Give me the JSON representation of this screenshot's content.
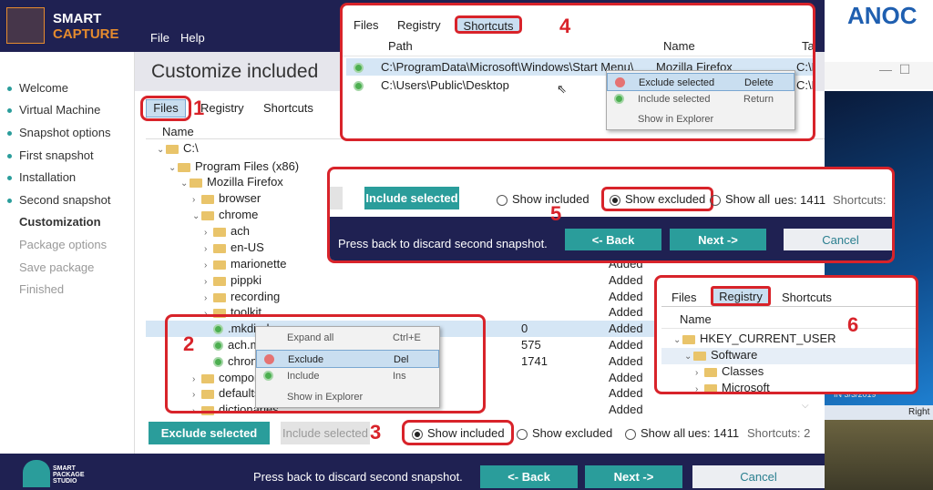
{
  "app": {
    "brand_line1": "SMART",
    "brand_line2": "CAPTURE",
    "menu": [
      "File",
      "Help"
    ],
    "footer_logo": "SMART PACKAGE STUDIO",
    "accent": "#2a9d9b",
    "navy": "#1f2152"
  },
  "sidebar": {
    "items": [
      {
        "label": "Welcome",
        "state": "done"
      },
      {
        "label": "Virtual Machine",
        "state": "done"
      },
      {
        "label": "Snapshot options",
        "state": "done"
      },
      {
        "label": "First snapshot",
        "state": "done"
      },
      {
        "label": "Installation",
        "state": "done"
      },
      {
        "label": "Second snapshot",
        "state": "done"
      },
      {
        "label": "Customization",
        "state": "current"
      },
      {
        "label": "Package options",
        "state": "pending"
      },
      {
        "label": "Save package",
        "state": "pending"
      },
      {
        "label": "Finished",
        "state": "pending"
      }
    ]
  },
  "main": {
    "title": "Customize included",
    "tabs": [
      "Files",
      "Registry",
      "Shortcuts"
    ],
    "active_tab": "Files",
    "column_name": "Name",
    "tree": [
      {
        "level": 0,
        "name": "C:\\",
        "open": true,
        "icon": "folder"
      },
      {
        "level": 1,
        "name": "Program Files (x86)",
        "open": true,
        "icon": "folder"
      },
      {
        "level": 2,
        "name": "Mozilla Firefox",
        "open": true,
        "icon": "folder-added"
      },
      {
        "level": 3,
        "name": "browser",
        "icon": "folder-added"
      },
      {
        "level": 3,
        "name": "chrome",
        "open": true,
        "icon": "folder-added"
      },
      {
        "level": 4,
        "name": "ach",
        "icon": "folder-added"
      },
      {
        "level": 4,
        "name": "en-US",
        "icon": "folder-added"
      },
      {
        "level": 4,
        "name": "marionette",
        "icon": "folder-added",
        "status": "Added"
      },
      {
        "level": 4,
        "name": "pippki",
        "icon": "folder-added",
        "status": "Added"
      },
      {
        "level": 4,
        "name": "recording",
        "icon": "folder-added",
        "status": "Added"
      },
      {
        "level": 4,
        "name": "toolkit",
        "icon": "folder-added",
        "status": "Added"
      },
      {
        "level": 4,
        "name": ".mkdir.d",
        "icon": "file-added",
        "size": "0",
        "status": "Added",
        "selected": true
      },
      {
        "level": 4,
        "name": "ach.manifest",
        "icon": "file-added",
        "size": "575",
        "status": "Added"
      },
      {
        "level": 4,
        "name": "chrome.manifest",
        "icon": "file-added",
        "size": "1741",
        "status": "Added"
      },
      {
        "level": 3,
        "name": "components",
        "icon": "folder-added",
        "status": "Added"
      },
      {
        "level": 3,
        "name": "defaults",
        "icon": "folder-added",
        "status": "Added"
      },
      {
        "level": 3,
        "name": "dictionaries",
        "icon": "folder-added",
        "status": "Added"
      }
    ],
    "context_menu": [
      {
        "label": "Expand all",
        "key": "Ctrl+E"
      },
      {
        "label": "Exclude",
        "key": "Del",
        "icon": "minus-circle-icon",
        "hover": true
      },
      {
        "label": "Include",
        "key": "Ins",
        "icon": "plus-circle-icon"
      },
      {
        "label": "Show in Explorer",
        "key": ""
      }
    ],
    "exclude_btn": "Exclude selected",
    "include_btn": "Include selected",
    "radios": [
      "Show included",
      "Show excluded",
      "Show all"
    ],
    "selected_radio": "Show included",
    "counts": "ues: 1411",
    "shortcuts_count": "Shortcuts: 2",
    "footer_hint": "Press back to discard second snapshot.",
    "back": "<- Back",
    "next": "Next ->",
    "cancel": "Cancel"
  },
  "panel4": {
    "tabs": [
      "Files",
      "Registry",
      "Shortcuts"
    ],
    "active_tab": "Shortcuts",
    "columns": [
      "Path",
      "Name",
      "Ta"
    ],
    "rows": [
      {
        "path": "C:\\ProgramData\\Microsoft\\Windows\\Start Menu\\",
        "name": "Mozilla Firefox",
        "target": "C:\\P"
      },
      {
        "path": "C:\\Users\\Public\\Desktop",
        "name": "",
        "target": "C:\\P"
      }
    ],
    "menu": [
      {
        "label": "Exclude selected",
        "key": "Delete",
        "icon": "minus-circle-icon"
      },
      {
        "label": "Include selected",
        "key": "Return",
        "icon": "plus-circle-icon"
      },
      {
        "label": "Show in Explorer",
        "key": ""
      }
    ]
  },
  "panel5": {
    "include_btn": "Include selected",
    "radios": [
      "Show included",
      "Show excluded",
      "Show all"
    ],
    "selected_radio": "Show excluded",
    "counts": "ues: 1411",
    "shortcuts": "Shortcuts: ",
    "hint": "Press back to discard second snapshot.",
    "back": "<- Back",
    "next": "Next ->",
    "cancel": "Cancel"
  },
  "panel6": {
    "tabs": [
      "Files",
      "Registry",
      "Shortcuts"
    ],
    "active_tab": "Registry",
    "column": "Name",
    "tree": [
      {
        "level": 0,
        "name": "HKEY_CURRENT_USER"
      },
      {
        "level": 1,
        "name": "Software"
      },
      {
        "level": 2,
        "name": "Classes"
      },
      {
        "level": 2,
        "name": "Microsoft"
      }
    ]
  },
  "annotations": [
    "1",
    "2",
    "3",
    "4",
    "5",
    "6"
  ],
  "desktop": {
    "clock": "IN   3/3/2019",
    "taskbar_text": "Right"
  }
}
